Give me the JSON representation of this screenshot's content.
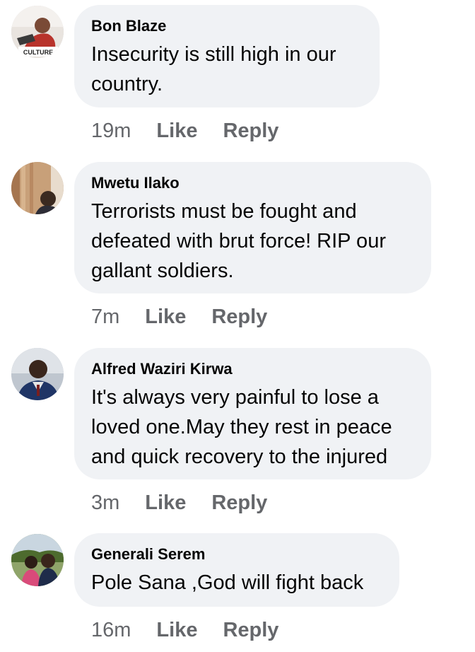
{
  "comments": [
    {
      "author": "Bon Blaze",
      "text_lines": [
        "Insecurity is still high in our",
        "country."
      ],
      "time": "19m",
      "like_label": "Like",
      "reply_label": "Reply",
      "avatar_badge": "CULTURE"
    },
    {
      "author": "Mwetu Ilako",
      "text_lines": [
        "Terrorists must be fought and",
        "defeated with brut force! RIP our",
        "gallant soldiers."
      ],
      "time": "7m",
      "like_label": "Like",
      "reply_label": "Reply"
    },
    {
      "author": "Alfred Waziri Kirwa",
      "text_lines": [
        "It's always very painful to lose a",
        "loved one.May they rest in peace",
        "and quick recovery to the injured"
      ],
      "time": "3m",
      "like_label": "Like",
      "reply_label": "Reply"
    },
    {
      "author": "Generali Serem",
      "text_lines": [
        "Pole Sana ,God will fight back"
      ],
      "time": "16m",
      "like_label": "Like",
      "reply_label": "Reply"
    }
  ],
  "colors": {
    "bubble_background": "#f0f2f5",
    "meta_text": "#65676b",
    "body_text": "#050505"
  }
}
